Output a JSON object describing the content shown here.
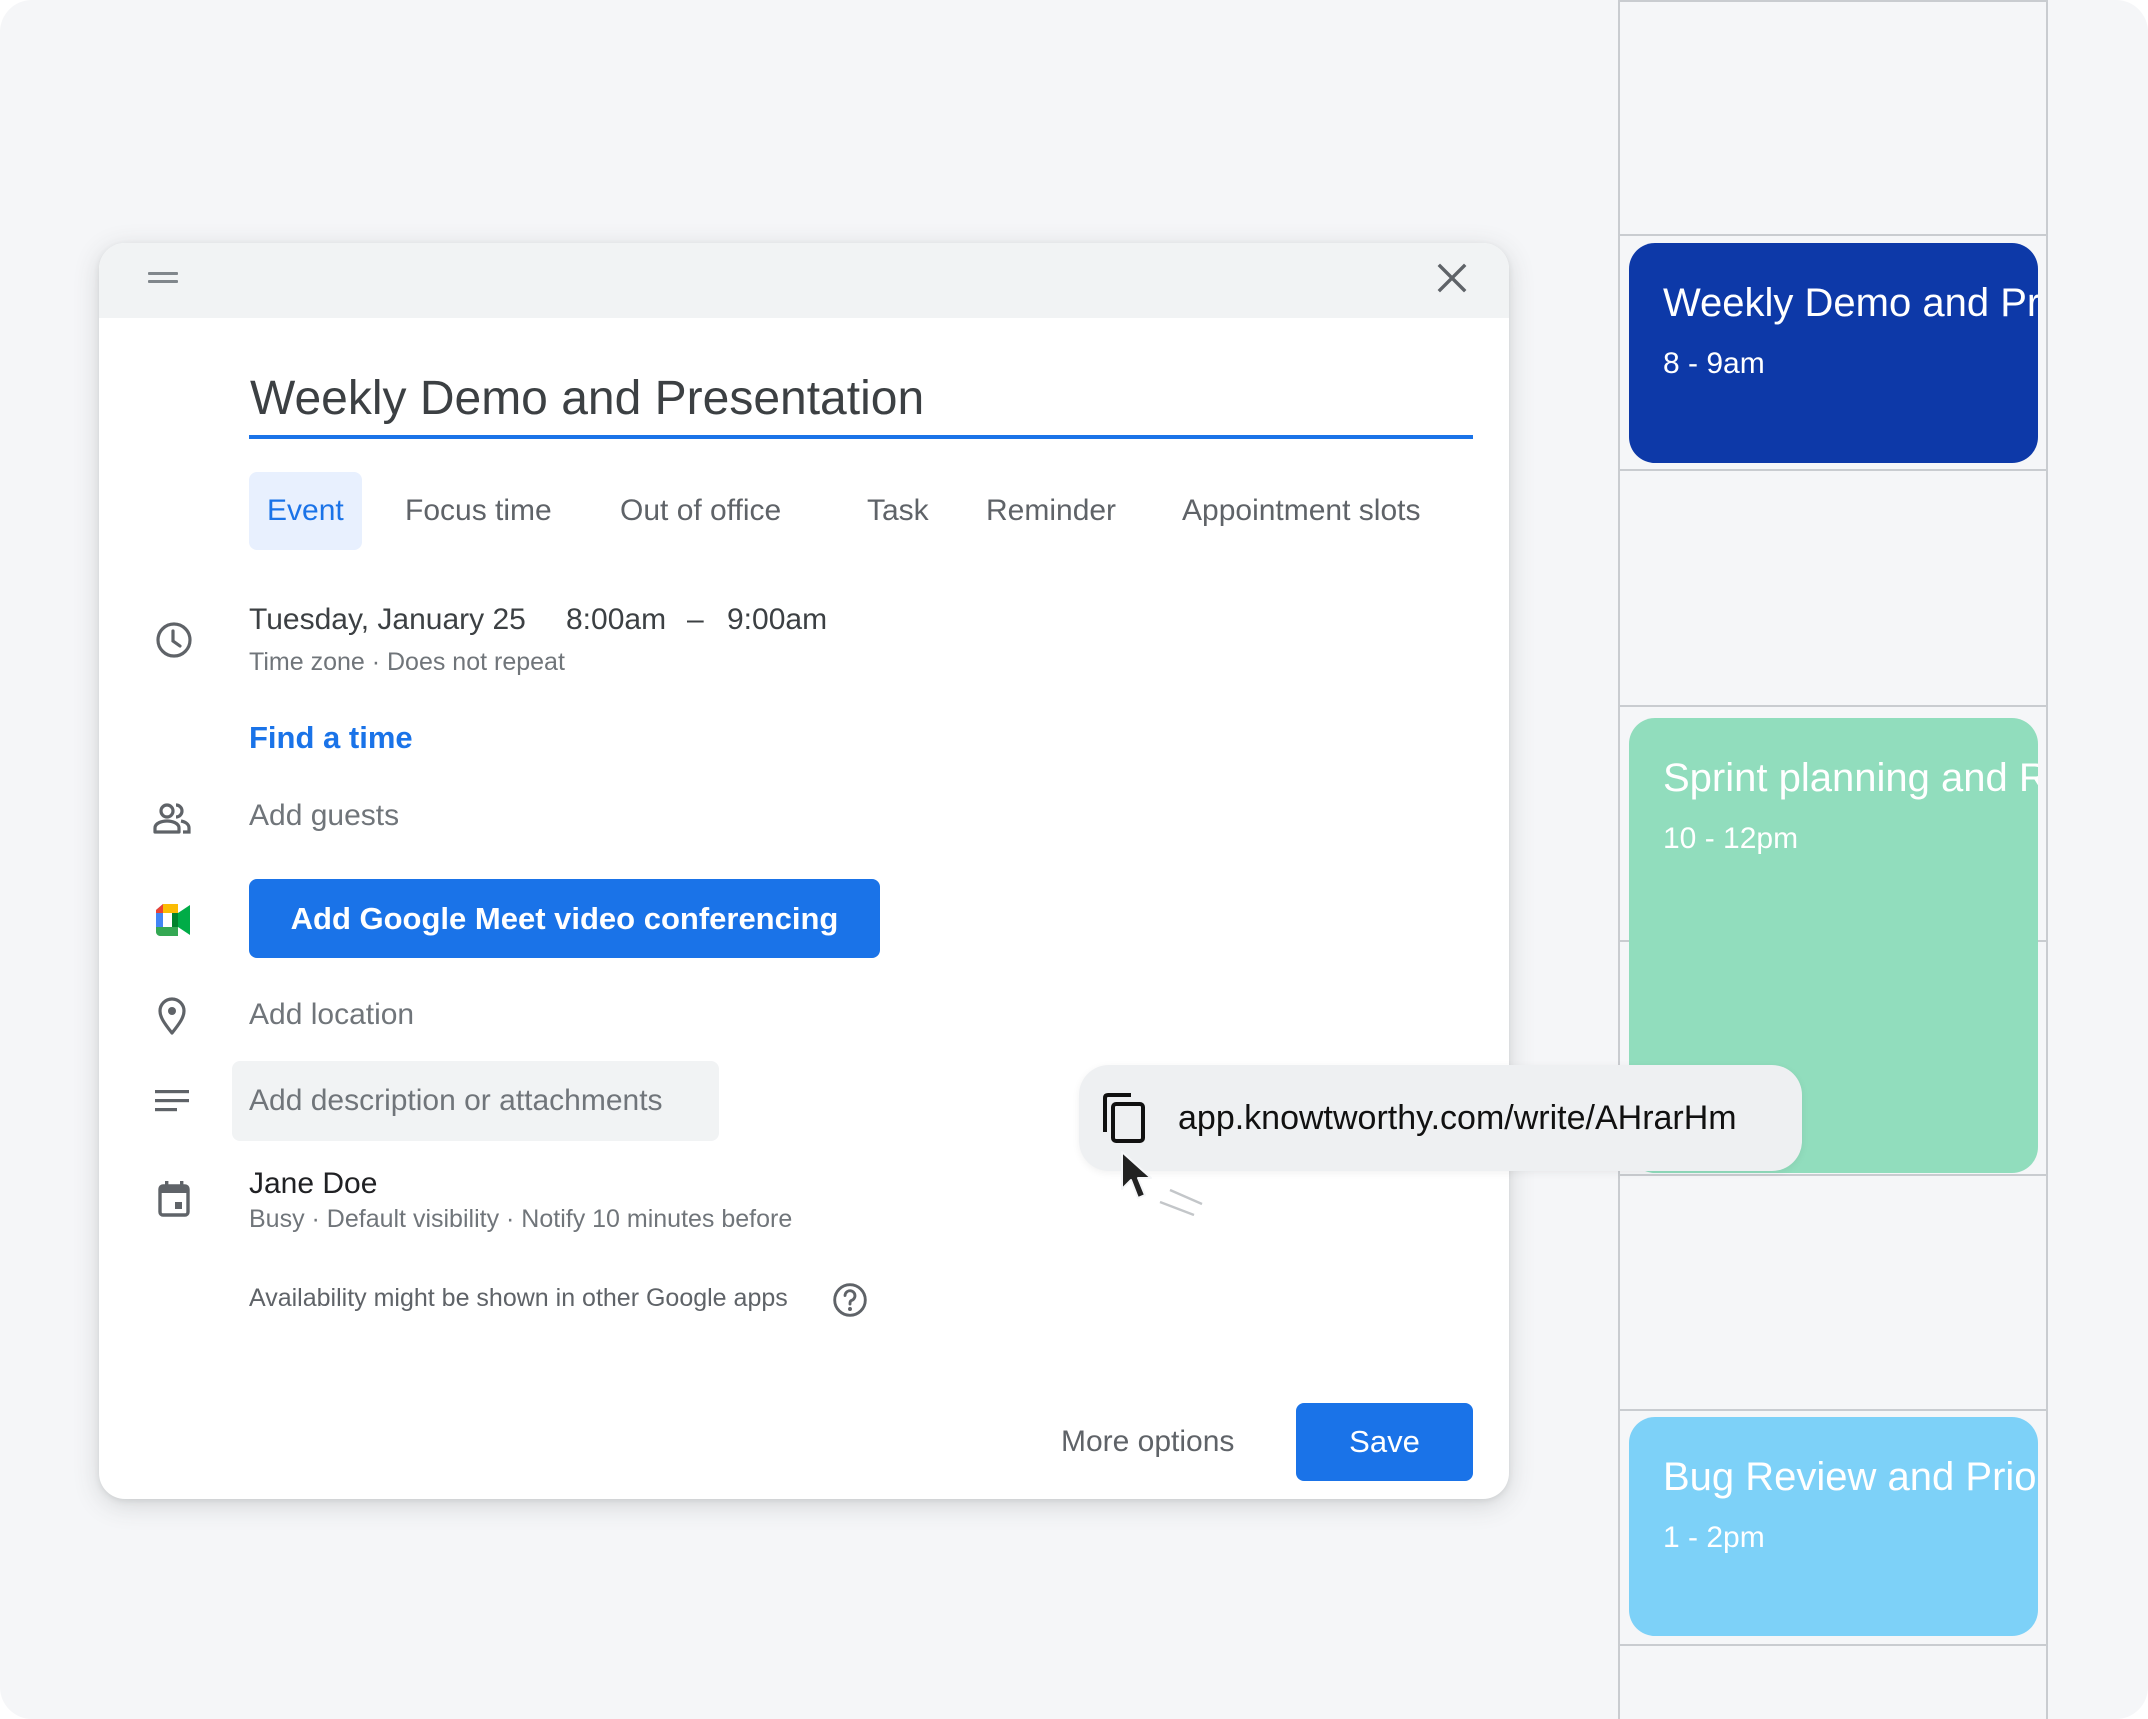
{
  "dialog": {
    "title": "Weekly Demo and Presentation",
    "tabs": [
      {
        "label": "Event",
        "active": true
      },
      {
        "label": "Focus time",
        "active": false
      },
      {
        "label": "Out of office",
        "active": false
      },
      {
        "label": "Task",
        "active": false
      },
      {
        "label": "Reminder",
        "active": false
      },
      {
        "label": "Appointment slots",
        "active": false
      }
    ],
    "datetime": {
      "date": "Tuesday, January 25",
      "start": "8:00am",
      "separator": "–",
      "end": "9:00am",
      "details": "Time zone · Does not repeat"
    },
    "find_time_label": "Find a time",
    "guests_placeholder": "Add guests",
    "meet_button_label": "Add Google Meet video conferencing",
    "location_placeholder": "Add location",
    "description_placeholder": "Add description or attachments",
    "calendar": {
      "owner": "Jane Doe",
      "details": "Busy · Default visibility · Notify 10 minutes before"
    },
    "availability_note": "Availability might be shown in other Google apps",
    "more_options_label": "More options",
    "save_label": "Save",
    "icons": {
      "drag": "drag-handle-icon",
      "close": "close-icon",
      "time": "clock-icon",
      "guests": "people-icon",
      "meet": "google-meet-icon",
      "location": "location-pin-icon",
      "description": "notes-icon",
      "calendar": "calendar-icon",
      "help": "help-circle-icon"
    }
  },
  "copy_link": {
    "url": "app.knowtworthy.com/write/AHrarHm",
    "icon": "copy-icon"
  },
  "calendar_events": [
    {
      "title": "Weekly Demo and Presentation",
      "time": "8 - 9am",
      "color": "#0d39a8"
    },
    {
      "title": "Sprint planning and Review",
      "time": "10 - 12pm",
      "color": "#91ddbd"
    },
    {
      "title": "Bug Review and Prioritization",
      "time": "1 - 2pm",
      "color": "#7dd1f8"
    }
  ],
  "colors": {
    "accent": "#1a73e8",
    "tab_active_bg": "#e8f0fe",
    "canvas_bg": "#f5f6f8"
  }
}
